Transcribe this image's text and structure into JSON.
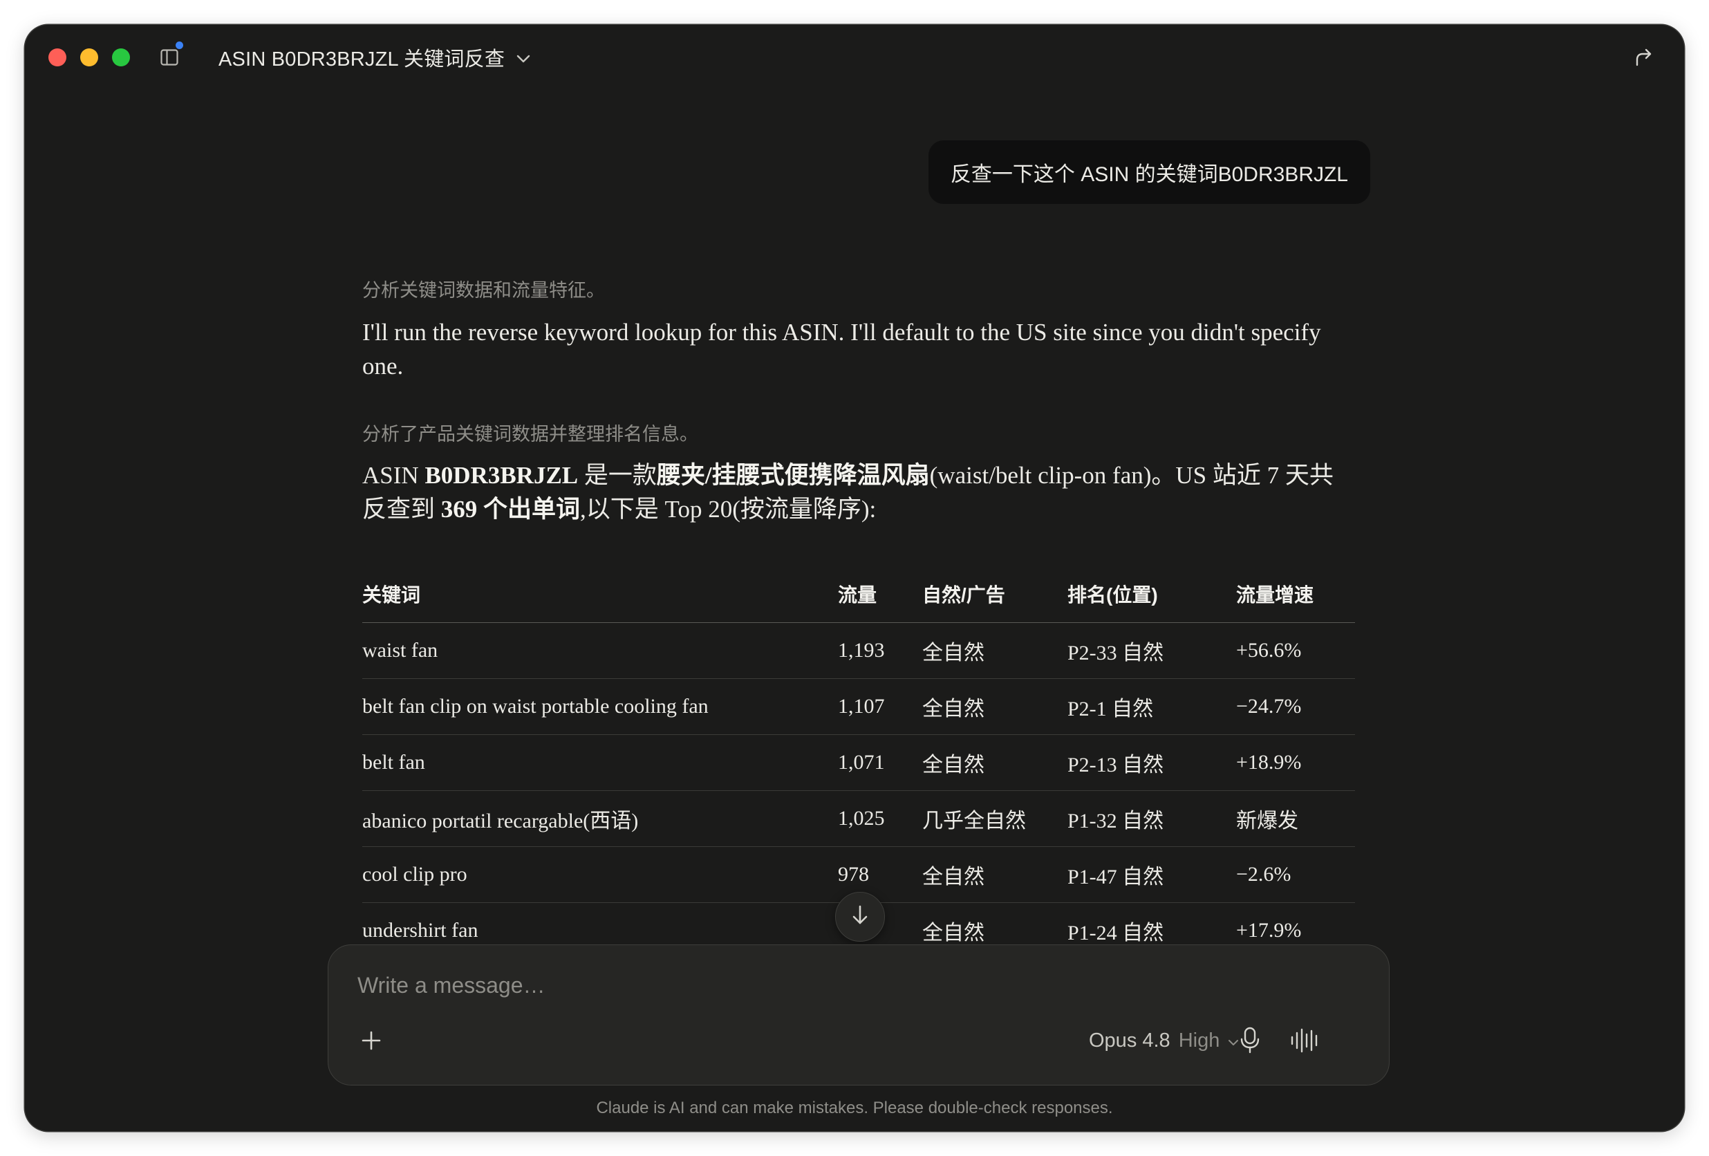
{
  "window": {
    "title": "ASIN B0DR3BRJZL 关键词反查"
  },
  "icons": {
    "sidebar": "sidebar-toggle-icon",
    "title_menu": "chevron-down-icon",
    "share": "share-icon",
    "scroll": "arrow-down-icon",
    "plus": "plus-icon",
    "mic": "microphone-icon",
    "voice": "voice-waveform-icon"
  },
  "colors": {
    "background": "#1b1b1a",
    "user_bubble": "#0f0f0f",
    "composer": "#262624",
    "text": "#ecebe6",
    "muted": "#8f8e89",
    "notification_dot": "#3b82f6"
  },
  "user_message": "反查一下这个 ASIN 的关键词B0DR3BRJZL",
  "assistant": {
    "thinking_1": "分析关键词数据和流量特征。",
    "reply_1": "I'll run the reverse keyword lookup for this ASIN. I'll default to the US site since you didn't specify one.",
    "thinking_2": "分析了产品关键词数据并整理排名信息。",
    "summary": {
      "p1": "ASIN ",
      "asin": "B0DR3BRJZL",
      "p2": " 是一款",
      "product": "腰夹/挂腰式便携降温风扇",
      "p3": "(waist/belt clip-on fan)。US 站近 7 天共反查到 ",
      "count": "369 个出单词",
      "p4": ",以下是 Top 20(按流量降序):"
    }
  },
  "table": {
    "headers": [
      "关键词",
      "流量",
      "自然/广告",
      "排名(位置)",
      "流量增速"
    ],
    "rows": [
      [
        "waist fan",
        "1,193",
        "全自然",
        "P2-33 自然",
        "+56.6%"
      ],
      [
        "belt fan clip on waist portable cooling fan",
        "1,107",
        "全自然",
        "P2-1 自然",
        "−24.7%"
      ],
      [
        "belt fan",
        "1,071",
        "全自然",
        "P2-13 自然",
        "+18.9%"
      ],
      [
        "abanico portatil recargable(西语)",
        "1,025",
        "几乎全自然",
        "P1-32 自然",
        "新爆发"
      ],
      [
        "cool clip pro",
        "978",
        "全自然",
        "P1-47 自然",
        "−2.6%"
      ],
      [
        "undershirt fan",
        "",
        "全自然",
        "P1-24 自然",
        "+17.9%"
      ]
    ]
  },
  "composer": {
    "placeholder": "Write a message…",
    "model": "Opus 4.8",
    "effort": "High"
  },
  "disclaimer": "Claude is AI and can make mistakes. Please double-check responses."
}
